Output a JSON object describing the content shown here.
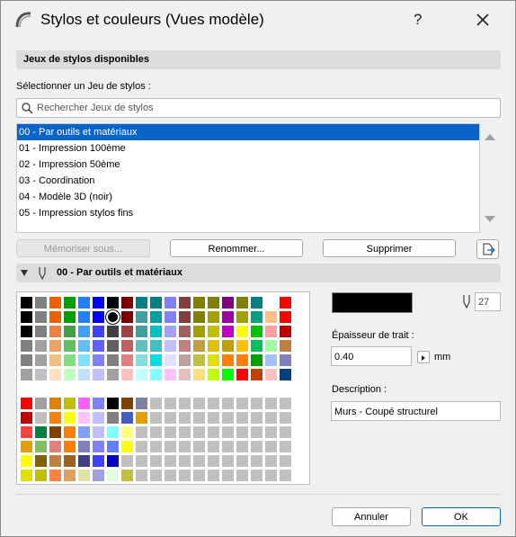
{
  "window": {
    "title": "Stylos et couleurs (Vues modèle)",
    "help_label": "?"
  },
  "penset_section": {
    "title": "Jeux de stylos disponibles"
  },
  "select_label": "Sélectionner un Jeu de stylos :",
  "search": {
    "placeholder": "Rechercher Jeux de stylos"
  },
  "pensets": [
    "00 - Par outils et matériaux",
    "01 - Impression 100ème",
    "02 - Impression 50ème",
    "03 - Coordination",
    "04 - Modèle 3D (noir)",
    "05 - Impression stylos fins"
  ],
  "selected_penset_index": 0,
  "buttons": {
    "memorize": "Mémoriser sous...",
    "rename": "Renommer...",
    "delete": "Supprimer",
    "cancel": "Annuler",
    "ok": "OK"
  },
  "pen_section": {
    "title": "00 - Par outils et matériaux"
  },
  "pen": {
    "color": "#000000",
    "number": "27",
    "thickness_label": "Épaisseur de trait :",
    "thickness": "0.40",
    "unit": "mm",
    "description_label": "Description :",
    "description": "Murs - Coupé structurel"
  },
  "palette": {
    "rows": [
      [
        "#000000",
        "#808080",
        "#f06000",
        "#00a000",
        "#2080ff",
        "#0000ff",
        "#000000",
        "#800000",
        "#008080",
        "#008080",
        "#8080ff",
        "#804040",
        "#808000",
        "#808000",
        "#800080",
        "#808000",
        "#008080",
        "#ffffff",
        "#ff0000"
      ],
      [
        "#000000",
        "#808080",
        "#f06000",
        "#00a000",
        "#2080ff",
        "#0000ff",
        "#000000",
        "#800000",
        "#40a0a0",
        "#00a0a0",
        "#8080ff",
        "#804040",
        "#808000",
        "#a0a000",
        "#a000a0",
        "#a0a000",
        "#00a080",
        "#ffc080",
        "#ff0000"
      ],
      [
        "#000000",
        "#808080",
        "#f08040",
        "#40a040",
        "#40a0ff",
        "#4040ff",
        "#404040",
        "#a04040",
        "#40a0a0",
        "#00c0c0",
        "#a0a0ff",
        "#a06060",
        "#a0a000",
        "#c0c000",
        "#c000c0",
        "#ffff00",
        "#00c000",
        "#ffa0a0",
        "#c00000"
      ],
      [
        "#808080",
        "#a0a0a0",
        "#f0a060",
        "#60c060",
        "#60c0ff",
        "#6060ff",
        "#606060",
        "#c06060",
        "#60c0c0",
        "#40c0c0",
        "#c0c0ff",
        "#c08080",
        "#c0a040",
        "#e0c000",
        "#c0a000",
        "#ffc000",
        "#00c060",
        "#a0ffa0",
        "#c08040"
      ],
      [
        "#808080",
        "#a0a0a0",
        "#f0c080",
        "#80e080",
        "#80e0ff",
        "#8080ff",
        "#808080",
        "#e08080",
        "#80e0e0",
        "#00e0e0",
        "#e0e0ff",
        "#c0a0a0",
        "#c0c040",
        "#e0e000",
        "#ff8000",
        "#ff8000",
        "#00a000",
        "#a0c0ff",
        "#8080c0"
      ],
      [
        "#a0a0a0",
        "#c0c0c0",
        "#ffe0c0",
        "#c0ffc0",
        "#c0e0ff",
        "#c0c0ff",
        "#a0a0a0",
        "#ffc0c0",
        "#c0ffff",
        "#80ffff",
        "#ffc0ff",
        "#e0c0c0",
        "#ffe080",
        "#c0ff00",
        "#00ff00",
        "#ff0000",
        "#c04000",
        "#ffc0c0",
        "#004080"
      ],
      [
        "#ffffff",
        "#ffffff",
        "#ffffff",
        "#ffffff",
        "#ffffff",
        "#ffffff",
        "#ffffff",
        "#ffffff",
        "#ffffff",
        "#ffffff",
        "#ffffff",
        "#ffffff",
        "#ffffff",
        "#ffffff",
        "#ffffff",
        "#ffffff",
        "#ffffff",
        "#ffffff",
        "#ffffff"
      ],
      [
        "#ff0000",
        "#a0a0a0",
        "#e08000",
        "#c0c000",
        "#ff60ff",
        "#8080ff",
        "#000000",
        "#804000",
        "#8080a0",
        "#c0c0c0",
        "#c0c0c0",
        "#c0c0c0",
        "#c0c0c0",
        "#c0c0c0",
        "#c0c0c0",
        "#c0c0c0",
        "#c0c0c0",
        "#c0c0c0",
        "#c0c0c0"
      ],
      [
        "#c00000",
        "#c0c0c0",
        "#ff8000",
        "#ffff00",
        "#ffc0ff",
        "#c0c0ff",
        "#808080",
        "#4060c0",
        "#e0a000",
        "#c0c0c0",
        "#c0c0c0",
        "#c0c0c0",
        "#c0c0c0",
        "#c0c0c0",
        "#c0c0c0",
        "#c0c0c0",
        "#c0c0c0",
        "#c0c0c0",
        "#c0c0c0"
      ],
      [
        "#ff4040",
        "#008040",
        "#804000",
        "#ff8000",
        "#80a0ff",
        "#c0c0ff",
        "#80ffff",
        "#ffff80",
        "#c0c0c0",
        "#c0c0c0",
        "#c0c0c0",
        "#c0c0c0",
        "#c0c0c0",
        "#c0c0c0",
        "#c0c0c0",
        "#c0c0c0",
        "#c0c0c0",
        "#c0c0c0",
        "#c0c0c0"
      ],
      [
        "#e0a000",
        "#80c060",
        "#e08080",
        "#ff8000",
        "#8080c0",
        "#8080ff",
        "#6080ff",
        "#ffff00",
        "#c0c0c0",
        "#c0c0c0",
        "#c0c0c0",
        "#c0c0c0",
        "#c0c0c0",
        "#c0c0c0",
        "#c0c0c0",
        "#c0c0c0",
        "#c0c0c0",
        "#c0c0c0",
        "#c0c0c0"
      ],
      [
        "#ffff00",
        "#806000",
        "#c08040",
        "#a06020",
        "#404080",
        "#4040ff",
        "#0000c0",
        "#c0c0c0",
        "#c0c0c0",
        "#c0c0c0",
        "#c0c0c0",
        "#c0c0c0",
        "#c0c0c0",
        "#c0c0c0",
        "#c0c0c0",
        "#c0c0c0",
        "#c0c0c0",
        "#c0c0c0",
        "#c0c0c0"
      ],
      [
        "#e0e000",
        "#c0c000",
        "#ff8040",
        "#e0a060",
        "#e0e0a0",
        "#a0a0e0",
        "#e0ffe0",
        "#c0c040",
        "#c0c0c0",
        "#c0c0c0",
        "#c0c0c0",
        "#c0c0c0",
        "#c0c0c0",
        "#c0c0c0",
        "#c0c0c0",
        "#c0c0c0",
        "#c0c0c0",
        "#c0c0c0",
        "#c0c0c0"
      ]
    ],
    "selected": [
      1,
      6
    ]
  }
}
